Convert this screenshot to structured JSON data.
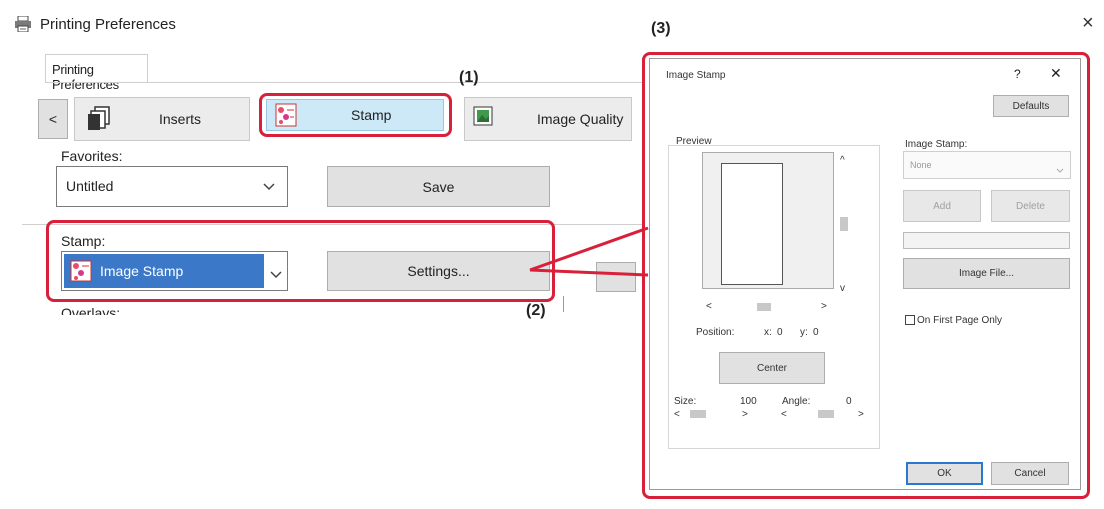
{
  "window": {
    "title": "Printing Preferences",
    "close_glyph": "×",
    "tab": "Printing Preferences"
  },
  "ribbon": {
    "prev_label": "<",
    "items": [
      {
        "label": "Inserts",
        "icon": "inserts-icon"
      },
      {
        "label": "Stamp",
        "icon": "stamp-icon"
      },
      {
        "label": "Image Quality",
        "icon": "image-quality-icon"
      }
    ]
  },
  "favorites": {
    "label": "Favorites:",
    "value": "Untitled",
    "save_label": "Save"
  },
  "stamp": {
    "label": "Stamp:",
    "value": "Image Stamp",
    "settings_label": "Settings..."
  },
  "overlays": {
    "label": "Overlays:"
  },
  "callouts": {
    "one": "(1)",
    "two": "(2)",
    "three": "(3)"
  },
  "dialog": {
    "title": "Image Stamp",
    "help_glyph": "?",
    "close_glyph": "✕",
    "defaults_label": "Defaults",
    "preview_label": "Preview",
    "image_stamp_label": "Image Stamp:",
    "image_stamp_value": "None",
    "add_label": "Add",
    "delete_label": "Delete",
    "image_file_label": "Image File...",
    "first_page_label": "On First Page Only",
    "position_label": "Position:",
    "x_label": "x:",
    "x_value": "0",
    "y_label": "y:",
    "y_value": "0",
    "center_label": "Center",
    "size_label": "Size:",
    "size_value": "100",
    "angle_label": "Angle:",
    "angle_value": "0",
    "ok_label": "OK",
    "cancel_label": "Cancel",
    "arrow_left": "<",
    "arrow_right": ">",
    "arrow_up": "^",
    "arrow_down": "v"
  },
  "colors": {
    "callout_red": "#d8203a",
    "selected_blue": "#3c78c8",
    "selected_tab": "#cde8f7"
  }
}
